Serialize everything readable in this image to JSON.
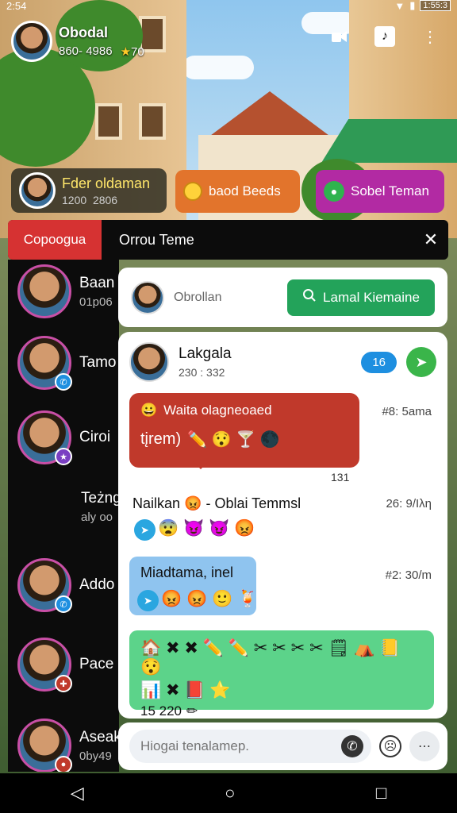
{
  "status": {
    "time": "2:54",
    "battery": "1:55:3"
  },
  "profile": {
    "name": "Obodal",
    "stat_a": "860- 4986",
    "stat_b": "70"
  },
  "pills": {
    "user": {
      "title": "Fder oldaman",
      "sub_a": "1200",
      "sub_b": "2806"
    },
    "beeds": {
      "label": "baod Beeds"
    },
    "sobel": {
      "label": "Sobel Teman"
    }
  },
  "tabs": {
    "active": "Copoogua",
    "title": "Orrou Teme"
  },
  "contacts": [
    {
      "name": "Baan",
      "sub": "01p06"
    },
    {
      "name": "Tamo",
      "sub": ""
    },
    {
      "name": "Ciroi",
      "sub": ""
    },
    {
      "name": "Teżng",
      "sub": "aly oo"
    },
    {
      "name": "Addo",
      "sub": ""
    },
    {
      "name": "Pace",
      "sub": ""
    },
    {
      "name": "Aseak",
      "sub": "0by49"
    }
  ],
  "search_card": {
    "label": "Obrollan",
    "button": "Lamal Kiemaine"
  },
  "chat": {
    "name": "Lakgala",
    "status": "230 : 332",
    "count": "16",
    "messages": {
      "m1_title": "Waita olagneoaed",
      "m1_text": "tįrem)",
      "m1_time": "#8: 5ama",
      "m1_count": "131",
      "m2_text": "Nailkan",
      "m2_rest": "- Oblai Temmsl",
      "m2_time": "26: 9/Iλη",
      "m3_text": "Miadtama, inel",
      "m3_time": "#2: 30/m",
      "panel_num": "15 220"
    }
  },
  "input": {
    "placeholder": "Hiogai tenalamep."
  },
  "colors": {
    "accent_red": "#d63232",
    "accent_green": "#23a35a",
    "accent_magenta": "#b22aa3",
    "accent_orange": "#e2742c"
  },
  "icons": [
    "mic-off-icon",
    "tiktok-icon",
    "more-vert-icon",
    "close-icon",
    "search-icon",
    "send-icon",
    "whatsapp-icon",
    "sticker-icon",
    "more-icon",
    "back-icon",
    "home-icon",
    "recents-icon"
  ]
}
